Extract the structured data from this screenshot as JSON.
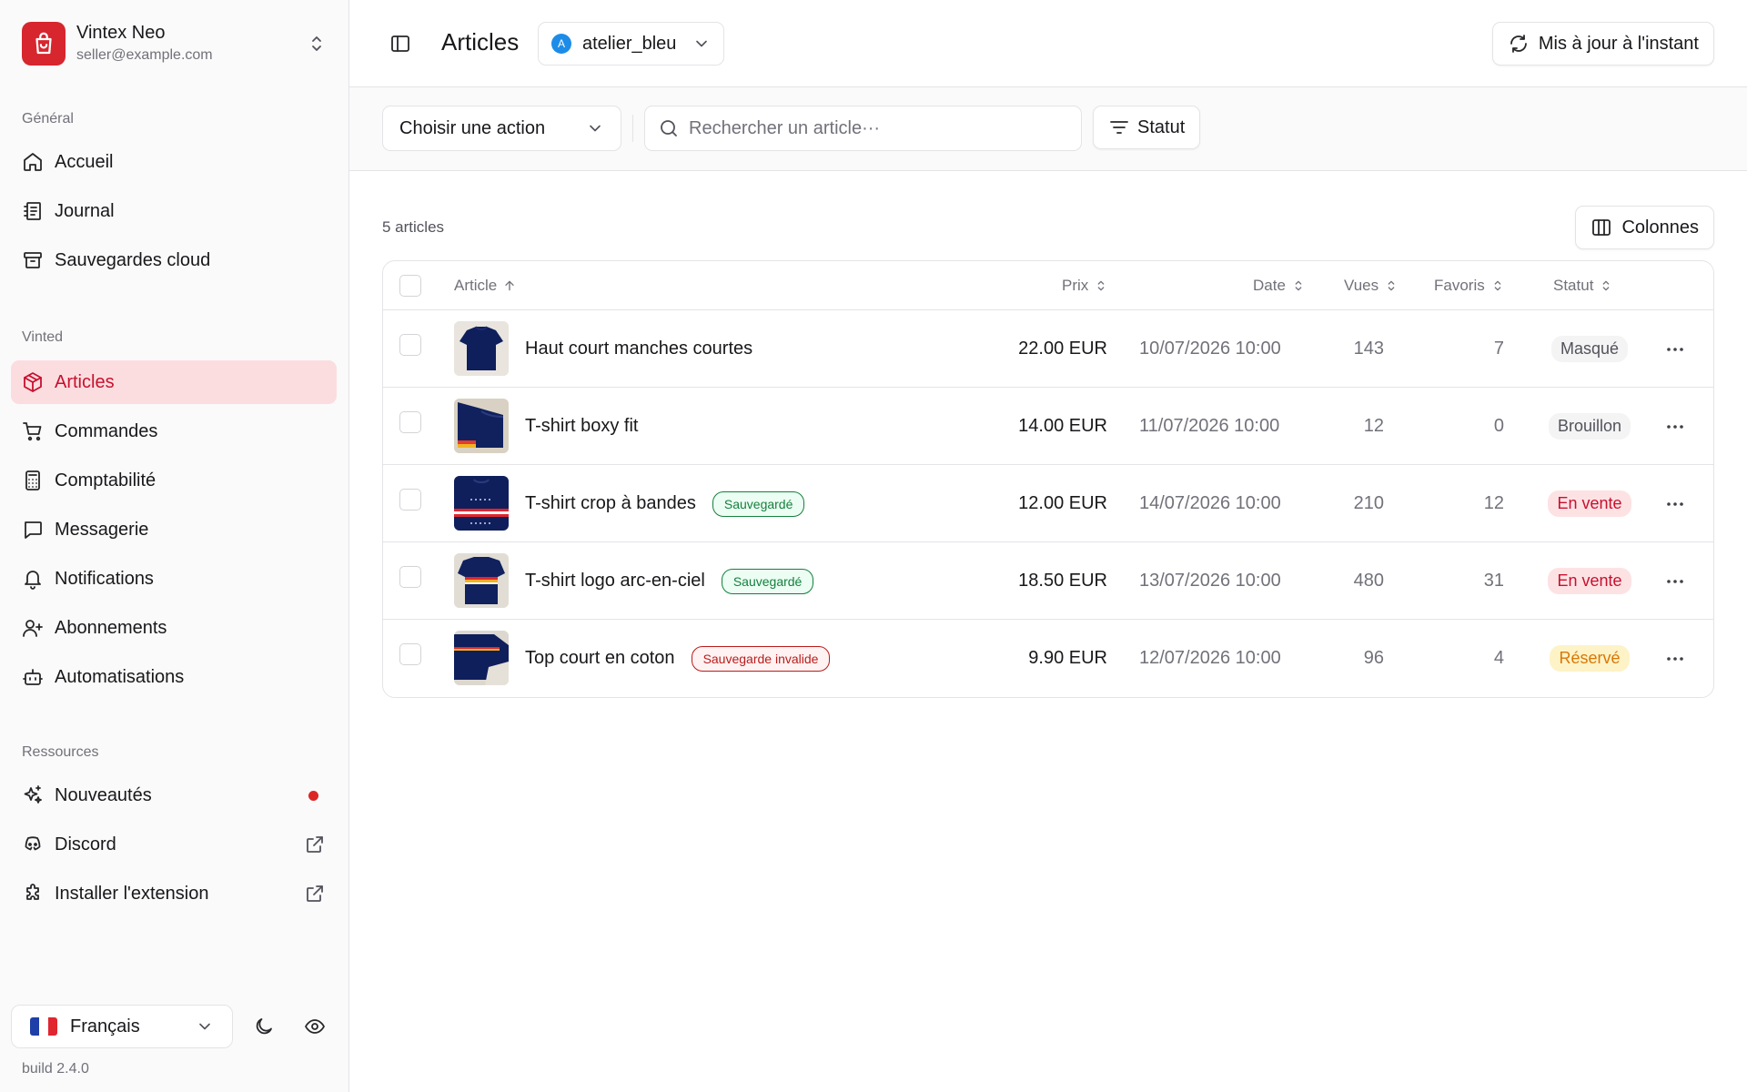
{
  "account": {
    "name": "Vintex Neo",
    "email": "seller@example.com",
    "logo_color": "#d7262e"
  },
  "sidebar": {
    "groups": [
      {
        "label": "Général",
        "items": [
          {
            "label": "Accueil",
            "icon": "home-icon"
          },
          {
            "label": "Journal",
            "icon": "journal-icon"
          },
          {
            "label": "Sauvegardes cloud",
            "icon": "archive-icon"
          }
        ]
      },
      {
        "label": "Vinted",
        "items": [
          {
            "label": "Articles",
            "icon": "package-icon",
            "active": true
          },
          {
            "label": "Commandes",
            "icon": "cart-icon"
          },
          {
            "label": "Comptabilité",
            "icon": "calculator-icon"
          },
          {
            "label": "Messagerie",
            "icon": "message-icon"
          },
          {
            "label": "Notifications",
            "icon": "bell-icon"
          },
          {
            "label": "Abonnements",
            "icon": "user-plus-icon"
          },
          {
            "label": "Automatisations",
            "icon": "bot-icon"
          }
        ]
      },
      {
        "label": "Ressources",
        "items": [
          {
            "label": "Nouveautés",
            "icon": "sparkles-icon",
            "badge": "new-dot"
          },
          {
            "label": "Discord",
            "icon": "discord-icon",
            "trailing": "external-link-icon"
          },
          {
            "label": "Installer l'extension",
            "icon": "puzzle-icon",
            "trailing": "external-link-icon"
          }
        ]
      }
    ],
    "language": "Français",
    "build": "build 2.4.0"
  },
  "header": {
    "title": "Articles",
    "shop": {
      "avatar_letter": "A",
      "name": "atelier_bleu"
    },
    "refresh_label": "Mis à jour à l'instant"
  },
  "toolbar": {
    "action_select": "Choisir une action",
    "search_placeholder": "Rechercher un article···",
    "status_filter": "Statut"
  },
  "list": {
    "count_label": "5 articles",
    "columns_button": "Colonnes",
    "columns": {
      "article": "Article",
      "price": "Prix",
      "date": "Date",
      "views": "Vues",
      "favorites": "Favoris",
      "status": "Statut"
    },
    "rows": [
      {
        "title": "Haut court manches courtes",
        "tag": "",
        "tag_kind": "",
        "price": "22.00 EUR",
        "date": "10/07/2026 10:00",
        "views": "143",
        "favorites": "7",
        "status": "Masqué",
        "status_kind": "hidden"
      },
      {
        "title": "T-shirt boxy fit",
        "tag": "",
        "tag_kind": "",
        "price": "14.00 EUR",
        "date": "11/07/2026 10:00",
        "views": "12",
        "favorites": "0",
        "status": "Brouillon",
        "status_kind": "draft"
      },
      {
        "title": "T-shirt crop à bandes",
        "tag": "Sauvegardé",
        "tag_kind": "ok",
        "price": "12.00 EUR",
        "date": "14/07/2026 10:00",
        "views": "210",
        "favorites": "12",
        "status": "En vente",
        "status_kind": "sale"
      },
      {
        "title": "T-shirt logo arc-en-ciel",
        "tag": "Sauvegardé",
        "tag_kind": "ok",
        "price": "18.50 EUR",
        "date": "13/07/2026 10:00",
        "views": "480",
        "favorites": "31",
        "status": "En vente",
        "status_kind": "sale"
      },
      {
        "title": "Top court en coton",
        "tag": "Sauvegarde invalide",
        "tag_kind": "bad",
        "price": "9.90 EUR",
        "date": "12/07/2026 10:00",
        "views": "96",
        "favorites": "4",
        "status": "Réservé",
        "status_kind": "reserved"
      }
    ]
  },
  "colors": {
    "accent": "#c8102e",
    "accent_bg": "#fbdde0",
    "sale": "#c8102e",
    "reserved": "#d97706",
    "saved": "#15803d",
    "invalid": "#b91c1c"
  }
}
